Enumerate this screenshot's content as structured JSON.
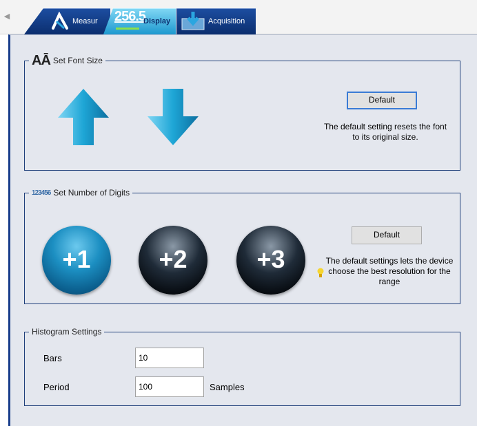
{
  "tabs": [
    {
      "label": "Measur"
    },
    {
      "label": "Display",
      "reading": "256.5"
    },
    {
      "label": "Acquisition"
    }
  ],
  "font_group": {
    "legend": "Set Font Size",
    "legend_icon": "AĀ",
    "default_label": "Default",
    "note": "The default setting resets the font to its original size."
  },
  "digits_group": {
    "legend": "Set Number of Digits",
    "legend_icon": "123456",
    "buttons": [
      "+1",
      "+2",
      "+3"
    ],
    "default_label": "Default",
    "note": "The default settings lets the device choose the best resolution for the range"
  },
  "histogram": {
    "legend": "Histogram Settings",
    "bars_label": "Bars",
    "bars_value": "10",
    "period_label": "Period",
    "period_value": "100",
    "period_unit": "Samples"
  },
  "colors": {
    "arrow": "#1ea6d6",
    "accent": "#1a3f8c",
    "panel_bg": "#e4e7ee"
  }
}
